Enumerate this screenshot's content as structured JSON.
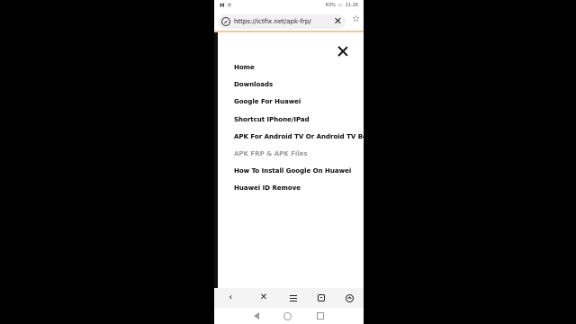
{
  "status_bar": {
    "battery": "63%",
    "time": "11:26"
  },
  "browser": {
    "url": "https://ictfix.net/apk-frp/",
    "close_glyph": "✕",
    "star_glyph": "☆"
  },
  "menu": {
    "items": [
      {
        "label": "Home"
      },
      {
        "label": "Downloads"
      },
      {
        "label": "Google For Huawei"
      },
      {
        "label": "Shortcut IPhone/IPad"
      },
      {
        "label": "APK For Android TV Or Android TV Box"
      },
      {
        "label": "APK FRP & APK Files"
      },
      {
        "label": "How To Install Google On Huawei"
      },
      {
        "label": "Huawei ID Remove"
      }
    ]
  },
  "toolbar": {
    "back_glyph": "‹",
    "close_glyph": "✕"
  },
  "icons": {
    "site": "site-info-icon",
    "close": "close-icon",
    "star": "bookmark-star-icon",
    "back": "back-icon",
    "menu": "menu-icon",
    "tabs": "tabs-icon",
    "home": "home-icon"
  },
  "colors": {
    "accent_underline": "#f2c79a",
    "muted_item": "#9a9a9a"
  }
}
